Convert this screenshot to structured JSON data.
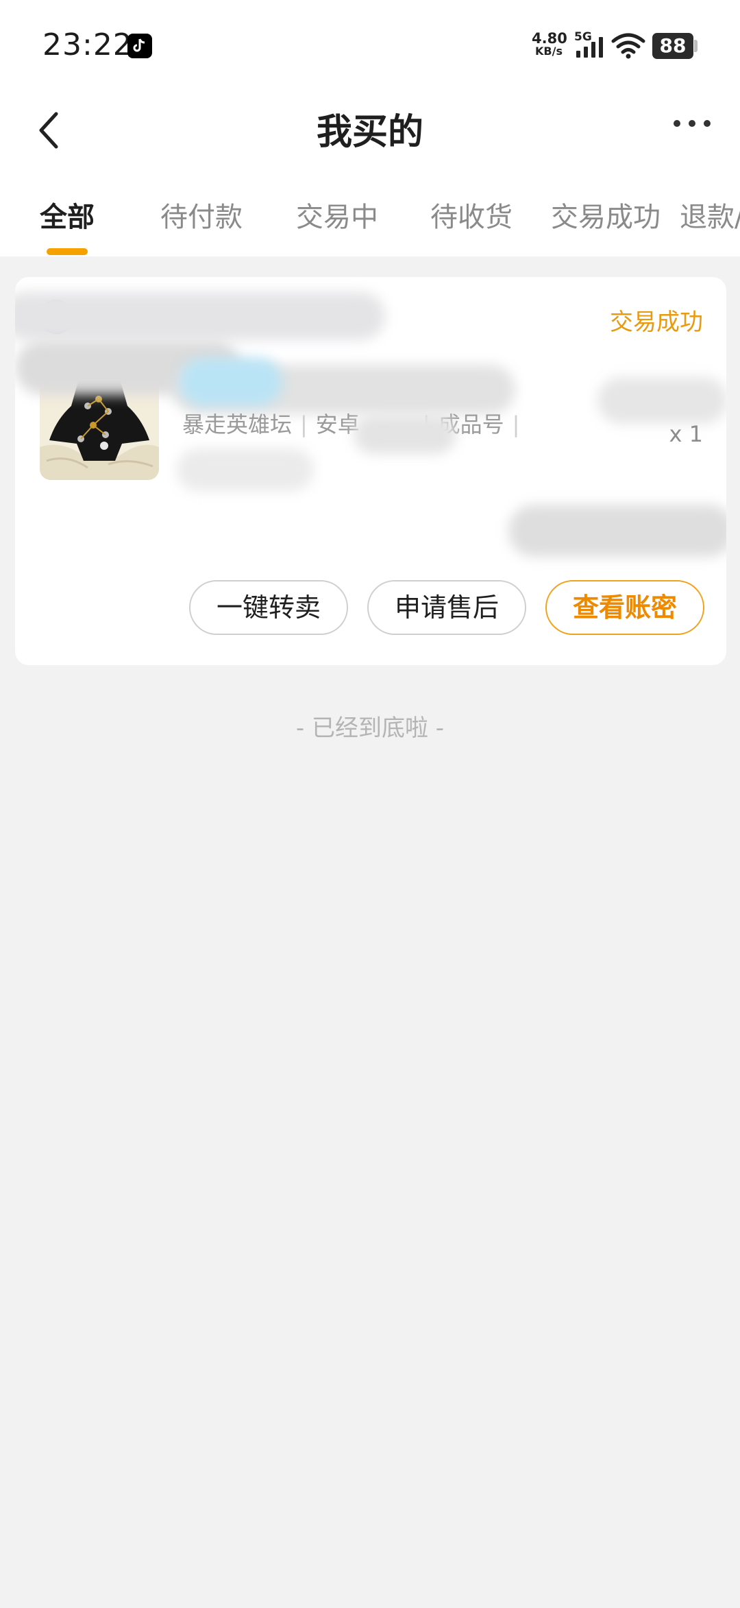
{
  "status_bar": {
    "time": "23:22",
    "app_icon": "tiktok-icon",
    "net_speed_value": "4.80",
    "net_speed_unit": "KB/s",
    "network": "5G",
    "battery": "88"
  },
  "header": {
    "back_icon": "chevron-left-icon",
    "title": "我买的",
    "more_icon": "more-horizontal-icon"
  },
  "tabs": [
    {
      "label": "全部",
      "active": true
    },
    {
      "label": "待付款",
      "active": false
    },
    {
      "label": "交易中",
      "active": false
    },
    {
      "label": "待收货",
      "active": false
    },
    {
      "label": "交易成功",
      "active": false
    },
    {
      "label": "退款/",
      "active": false
    }
  ],
  "order": {
    "status": "交易成功",
    "meta": [
      "暴走英雄坛",
      "安卓",
      "成品号"
    ],
    "quantity": "x 1",
    "actions": {
      "resell": "一键转卖",
      "after_sale": "申请售后",
      "view_account": "查看账密"
    }
  },
  "footer_tip": "- 已经到底啦 -",
  "colors": {
    "accent": "#F5A100",
    "status_text": "#E89A10",
    "background": "#F2F2F2"
  }
}
